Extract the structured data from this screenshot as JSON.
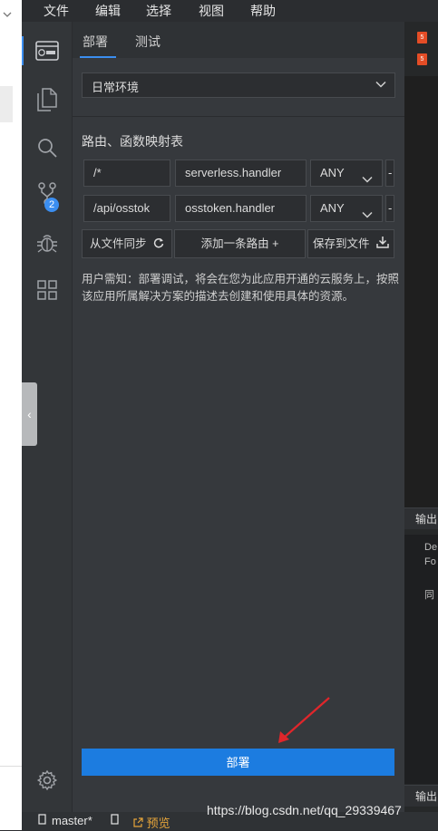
{
  "menubar": {
    "items": [
      "文件",
      "编辑",
      "选择",
      "视图",
      "帮助"
    ]
  },
  "activity": {
    "items": [
      {
        "name": "serverless-icon",
        "active": true
      },
      {
        "name": "files-icon"
      },
      {
        "name": "search-icon"
      },
      {
        "name": "source-control-icon",
        "badge": "2"
      },
      {
        "name": "debug-icon"
      },
      {
        "name": "extensions-icon"
      }
    ],
    "settings": "gear-icon",
    "collapse_glyph": "‹"
  },
  "panel": {
    "tabs": [
      "部署",
      "测试"
    ],
    "env_select": {
      "value": "日常环境"
    },
    "route_title": "路由、函数映射表",
    "routes": [
      {
        "path": "/*",
        "handler": "serverless.handler",
        "method": "ANY"
      },
      {
        "path": "/api/osstok",
        "handler": "osstoken.handler",
        "method": "ANY"
      }
    ],
    "actions": {
      "sync": "从文件同步",
      "add": "添加一条路由 +",
      "save": "保存到文件"
    },
    "notice": "用户需知：部署调试，将会在您为此应用开通的云服务上，按照该应用所属解决方案的描述去创建和使用具体的资源。",
    "deploy_label": "部署"
  },
  "editor": {
    "file_tab_icon": "html5-icon",
    "output_label": "输出",
    "output_lines": [
      "De",
      "Fo",
      "同"
    ],
    "output_label_2": "输出"
  },
  "status": {
    "branch": "master*",
    "preview": "预览"
  },
  "watermark": "https://blog.csdn.net/qq_29339467",
  "colors": {
    "accent": "#3b8ef0",
    "deploy": "#1c7ce0",
    "arrow": "#e0262b",
    "preview": "#e5a43a"
  }
}
